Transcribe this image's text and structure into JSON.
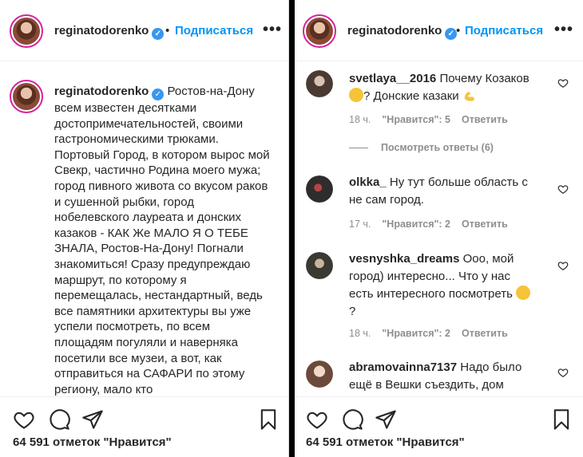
{
  "post": {
    "username": "reginatodorenko",
    "dot": "•",
    "follow_label": "Подписаться",
    "more": "•••",
    "likes": "64 591 отметок \"Нравится\""
  },
  "caption": {
    "username": "reginatodorenko",
    "text": "Ростов-на-Дону всем известен десятками достопримечательностей, своими гастрономическими трюками. Портовый Город, в котором вырос мой Свекр, частично Родина моего мужа; город пивного живота со вкусом раков и сушенной рыбки, город нобелевского лауреата и донских казаков - КАК Же МАЛО Я О ТЕБЕ ЗНАЛА, Ростов-На-Дону! Погнали знакомиться! Сразу предупреждаю маршрут, по которому я перемещалась, нестандартный, ведь все памятники архитектуры вы уже успели посмотреть, по всем площадям погуляли и наверняка посетили все музеи, а вот, как отправиться на САФАРИ по этому региону, мало кто"
  },
  "comments": [
    {
      "user": "svetlaya__2016",
      "text_a": "Почему Козаков",
      "text_b": "? Донские казаки",
      "time": "18 ч.",
      "likes": "\"Нравится\": 5",
      "reply": "Ответить"
    },
    {
      "user": "olkka_",
      "text": "Ну тут больше область с не сам город.",
      "time": "17 ч.",
      "likes": "\"Нравится\": 2",
      "reply": "Ответить"
    },
    {
      "user": "vesnyshka_dreams",
      "text_a": "Ооо, мой город) интересно... Что у нас есть интересного посмотреть",
      "text_b": "?",
      "time": "18 ч.",
      "likes": "\"Нравится\": 2",
      "reply": "Ответить"
    },
    {
      "user": "abramovainna7137",
      "text": "Надо было ещё в Вешки съездить, дом"
    }
  ],
  "view_replies": "Посмотреть ответы (6)",
  "icons": [
    "heart-icon",
    "comment-icon",
    "share-icon",
    "bookmark-icon",
    "verified-icon",
    "more-icon"
  ],
  "colors": {
    "accent": "#0095f6",
    "verified": "#3897f0",
    "muted": "#8e8e8e"
  }
}
